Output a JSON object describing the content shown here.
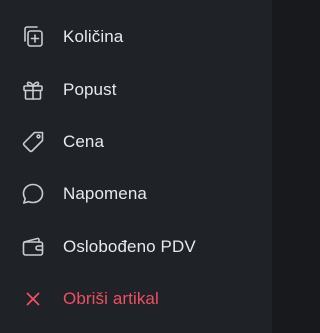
{
  "colors": {
    "background": "#1f2227",
    "text": "#e8e9eb",
    "icon": "#c9ccd1",
    "danger": "#ef4f63"
  },
  "menu": {
    "items": [
      {
        "label": "Količina",
        "icon": "add-box-icon"
      },
      {
        "label": "Popust",
        "icon": "gift-icon"
      },
      {
        "label": "Cena",
        "icon": "price-tag-icon"
      },
      {
        "label": "Napomena",
        "icon": "speech-bubble-icon"
      },
      {
        "label": "Oslobođeno PDV",
        "icon": "wallet-icon"
      },
      {
        "label": "Obriši artikal",
        "icon": "close-icon"
      }
    ]
  }
}
